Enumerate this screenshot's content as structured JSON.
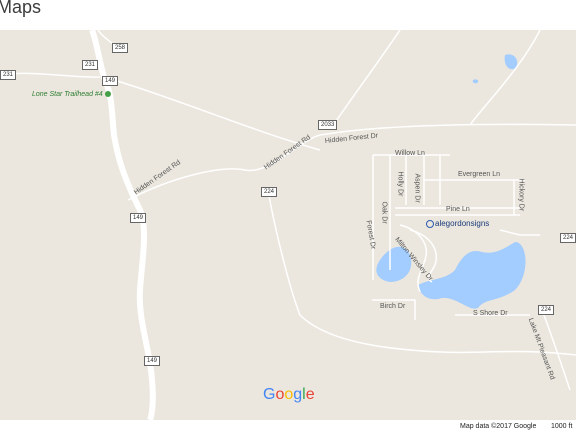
{
  "app": {
    "title": "Maps"
  },
  "map": {
    "poi": {
      "trailhead": "Lone Star Trailhead #4",
      "business": "alegordonsigns"
    },
    "shields": [
      "258",
      "231",
      "149",
      "231",
      "2033",
      "224",
      "149",
      "149",
      "224",
      "224"
    ],
    "roads": {
      "hidden_forest_1": "Hidden Forest Rd",
      "hidden_forest_2": "Hidden Forest Rd",
      "hidden_forest_dr": "Hidden Forest Dr",
      "willow": "Willow Ln",
      "evergreen": "Evergreen Ln",
      "pine": "Pine Ln",
      "oak": "Oak Dr",
      "holly": "Holly Dr",
      "aspen": "Aspen Dr",
      "hickory": "Hickory Dr",
      "forest": "Forest Dr",
      "milton_winsley": "Milton Winsley Dr",
      "birch": "Birch Dr",
      "s_shore": "S Shore Dr",
      "lake_mt_pleasant": "Lake Mt Pleasant Rd"
    },
    "brand": {
      "G": "G",
      "o1": "o",
      "o2": "o",
      "g": "g",
      "l": "l",
      "e": "e"
    },
    "brand_colors": {
      "blue": "#4285f4",
      "red": "#ea4335",
      "yellow": "#fbbc05",
      "green": "#34a853"
    },
    "colors": {
      "land": "#ebe7de",
      "water": "#a3ccff",
      "road": "#ffffff"
    }
  },
  "footer": {
    "attribution": "Map data ©2017 Google",
    "scale": "1000 ft"
  }
}
